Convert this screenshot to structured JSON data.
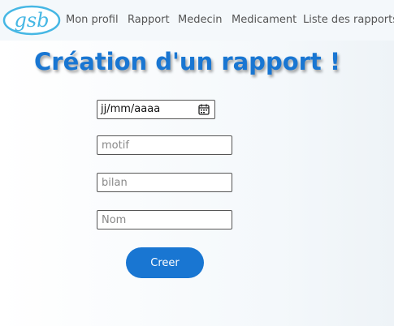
{
  "app": {
    "logo_text": "gsb"
  },
  "nav": {
    "items": [
      {
        "label": "Mon profil"
      },
      {
        "label": "Rapport"
      },
      {
        "label": "Medecin"
      },
      {
        "label": "Medicament"
      },
      {
        "label": "Liste des rapports"
      }
    ]
  },
  "page": {
    "title": "Création d'un rapport !"
  },
  "form": {
    "date": {
      "value": "jj/mm/aaaa",
      "icon": "calendar-icon"
    },
    "motif": {
      "placeholder": "motif",
      "value": ""
    },
    "bilan": {
      "placeholder": "bilan",
      "value": ""
    },
    "nom": {
      "placeholder": "Nom",
      "value": ""
    },
    "submit_label": "Creer"
  },
  "colors": {
    "accent": "#1976d2",
    "nav_background": "#f4f8fb",
    "nav_text": "#555555"
  }
}
